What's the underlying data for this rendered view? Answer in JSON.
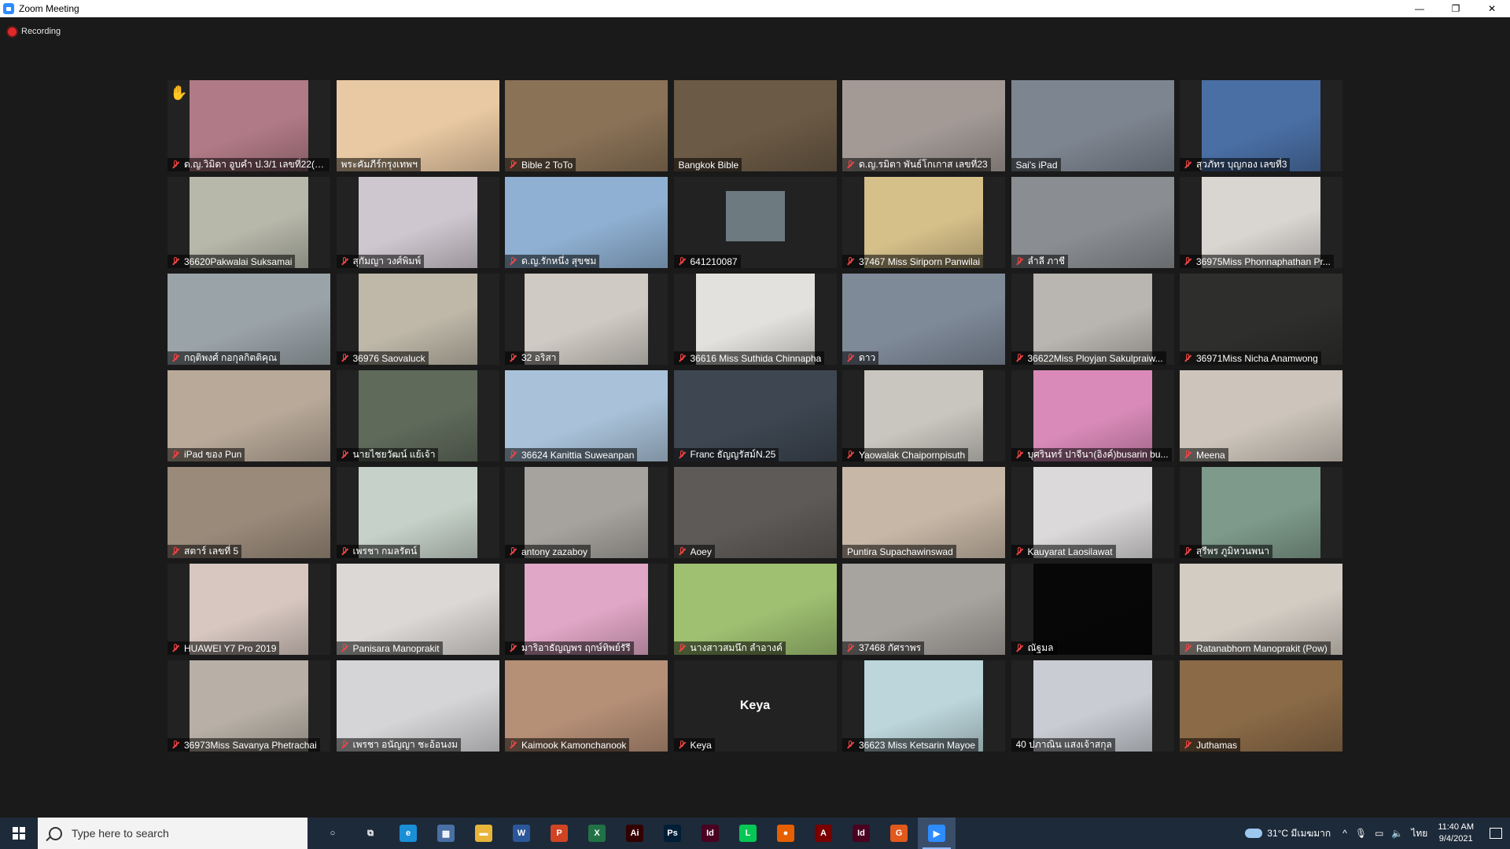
{
  "window": {
    "title": "Zoom Meeting",
    "minimize": "—",
    "restore": "❐",
    "close": "✕"
  },
  "recording": {
    "label": "Recording"
  },
  "participants": [
    {
      "name": "ด.ญ.วิมิดา อูบคำ ป.3/1 เลขที่22(N...",
      "muted": true,
      "video": "#b07a86",
      "style": "narrow2",
      "hand": true
    },
    {
      "name": "พระคัมภีร์กรุงเทพฯ",
      "muted": false,
      "video": "#e9c9a3",
      "style": "full"
    },
    {
      "name": "Bible 2 ToTo",
      "muted": true,
      "video": "#8a7257",
      "style": "full"
    },
    {
      "name": "Bangkok Bible",
      "muted": false,
      "video": "#6b5a45",
      "style": "full",
      "active": true
    },
    {
      "name": "ด.ญ.รมิตา พันธ์โกเกาส เลขที่23",
      "muted": true,
      "video": "#a39a96",
      "style": "full"
    },
    {
      "name": "Sai's iPad",
      "muted": false,
      "video": "#7d8590",
      "style": "full"
    },
    {
      "name": "สุวภัทร บุญกอง เลขที่3",
      "muted": true,
      "video": "#4a6fa5",
      "style": "narrow2"
    },
    {
      "name": "36620Pakwalai Suksamai",
      "muted": true,
      "video": "#b7b8aa",
      "style": "narrow2"
    },
    {
      "name": "สุกัมญา วงศ์พิมพ์",
      "muted": true,
      "video": "#cfc7cf",
      "style": "narrow2"
    },
    {
      "name": "ด.ญ.รักหนึ่ง สุขชม",
      "muted": true,
      "video": "#8fb0d2",
      "style": "full"
    },
    {
      "name": "641210087",
      "muted": true,
      "video": "#6d7a7f",
      "style": "tiny"
    },
    {
      "name": "37467 Miss Siriporn Panwilai",
      "muted": true,
      "video": "#d6c08a",
      "style": "narrow2"
    },
    {
      "name": "ลำลี ภาชี",
      "muted": true,
      "video": "#8a8e92",
      "style": "full"
    },
    {
      "name": "36975Miss Phonnaphathan Pr...",
      "muted": true,
      "video": "#d9d6d2",
      "style": "narrow2"
    },
    {
      "name": "กฤติพงศ์ กอกุลกิตติคุณ",
      "muted": true,
      "video": "#9aa3a8",
      "style": "full"
    },
    {
      "name": "36976 Saovaluck",
      "muted": true,
      "video": "#bfb8a9",
      "style": "narrow2"
    },
    {
      "name": "32 อริสา",
      "muted": true,
      "video": "#cfcac3",
      "style": "narrow"
    },
    {
      "name": "36616 Miss Suthida Chinnapha",
      "muted": true,
      "video": "#e3e1dd",
      "style": "narrow2"
    },
    {
      "name": "ดาว",
      "muted": true,
      "video": "#7f8a99",
      "style": "full"
    },
    {
      "name": "36622Miss Ployjan Sakulpraiw...",
      "muted": true,
      "video": "#b9b5b0",
      "style": "narrow2"
    },
    {
      "name": "36971Miss Nicha Anamwong",
      "muted": true,
      "video": "#2e2f2c",
      "style": "full"
    },
    {
      "name": "iPad ของ Pun",
      "muted": true,
      "video": "#b8a999",
      "style": "full"
    },
    {
      "name": "นายไชยวัฒน์ แย้เจ้า",
      "muted": true,
      "video": "#5f6a5b",
      "style": "narrow2"
    },
    {
      "name": "36624 Kanittia Suweanpan",
      "muted": true,
      "video": "#a9c2d9",
      "style": "full"
    },
    {
      "name": "Franc ธัญญรัสม์N.25",
      "muted": true,
      "video": "#3d4651",
      "style": "full"
    },
    {
      "name": "Yaowalak Chaipornpisuth",
      "muted": true,
      "video": "#c9c6bf",
      "style": "narrow2"
    },
    {
      "name": "บุศรินทร์ ปาจีนา(อิงค์)busarin bu...",
      "muted": true,
      "video": "#d98ab8",
      "style": "narrow2"
    },
    {
      "name": "Meena",
      "muted": true,
      "video": "#cdc5bb",
      "style": "full"
    },
    {
      "name": "สตาร์ เลขที่ 5",
      "muted": true,
      "video": "#9a8a7a",
      "style": "full"
    },
    {
      "name": "เพรชา กมลรัตน์",
      "muted": true,
      "video": "#c6d2c9",
      "style": "narrow2"
    },
    {
      "name": "antony zazaboy",
      "muted": true,
      "video": "#a6a39e",
      "style": "narrow"
    },
    {
      "name": "Aoey",
      "muted": true,
      "video": "#5e5a57",
      "style": "full"
    },
    {
      "name": "Puntira Supachawinswad",
      "muted": false,
      "video": "#c7b7a6",
      "style": "full"
    },
    {
      "name": "Kauyarat Laosilawat",
      "muted": true,
      "video": "#dbd9da",
      "style": "narrow2"
    },
    {
      "name": "สุรีพร ภูมิหวนพนา",
      "muted": true,
      "video": "#7d9a8a",
      "style": "narrow2"
    },
    {
      "name": "HUAWEI Y7 Pro 2019",
      "muted": true,
      "video": "#d7c7c0",
      "style": "narrow2"
    },
    {
      "name": "Panisara Manoprakit",
      "muted": true,
      "video": "#dcd8d5",
      "style": "full"
    },
    {
      "name": "มาริอาธัญญพร ฤกษ์ทิพย์รัรี",
      "muted": true,
      "video": "#e1a7c6",
      "style": "narrow"
    },
    {
      "name": "นางสาวสมนึก ลำอางค์",
      "muted": true,
      "video": "#9fc071",
      "style": "full"
    },
    {
      "name": "37468 กัศราพร",
      "muted": true,
      "video": "#a7a39f",
      "style": "full"
    },
    {
      "name": "ณัฐมล",
      "muted": true,
      "video": "#070707",
      "style": "narrow2"
    },
    {
      "name": "Ratanabhorn Manoprakit (Pow)",
      "muted": true,
      "video": "#d3ccc3",
      "style": "full"
    },
    {
      "name": "36973Miss Savanya Phetrachai",
      "muted": true,
      "video": "#b8b0a6",
      "style": "narrow2"
    },
    {
      "name": "เพรชา อนัญญา ชะอ้อนงม",
      "muted": true,
      "video": "#d5d5d8",
      "style": "full"
    },
    {
      "name": "Kaimook Kamonchanook",
      "muted": true,
      "video": "#b58f76",
      "style": "full"
    },
    {
      "name": "Keya",
      "muted": true,
      "video": "none",
      "style": "none",
      "center": "Keya"
    },
    {
      "name": "36623 Miss Ketsarin Mayoe",
      "muted": true,
      "video": "#bcd6db",
      "style": "narrow2"
    },
    {
      "name": "40 ปภาณิน แสงเจ้าสกุล",
      "muted": false,
      "video": "#c9cdd3",
      "style": "narrow2"
    },
    {
      "name": "Juthamas",
      "muted": true,
      "video": "#8a6a47",
      "style": "full"
    }
  ],
  "taskbar": {
    "search_placeholder": "Type here to search",
    "apps": [
      {
        "icon": "cortana-icon",
        "glyph": "○",
        "bg": "transparent"
      },
      {
        "icon": "task-view-icon",
        "glyph": "⧉",
        "bg": "transparent"
      },
      {
        "icon": "edge-icon",
        "glyph": "e",
        "bg": "#1b8fd6"
      },
      {
        "icon": "calculator-icon",
        "glyph": "▦",
        "bg": "#4a6fa5"
      },
      {
        "icon": "file-explorer-icon",
        "glyph": "▬",
        "bg": "#e8b43a"
      },
      {
        "icon": "word-icon",
        "glyph": "W",
        "bg": "#2b579a"
      },
      {
        "icon": "powerpoint-icon",
        "glyph": "P",
        "bg": "#d04423"
      },
      {
        "icon": "excel-icon",
        "glyph": "X",
        "bg": "#217346"
      },
      {
        "icon": "illustrator-icon",
        "glyph": "Ai",
        "bg": "#330000"
      },
      {
        "icon": "photoshop-icon",
        "glyph": "Ps",
        "bg": "#001e36"
      },
      {
        "icon": "indesign-icon",
        "glyph": "Id",
        "bg": "#49021f"
      },
      {
        "icon": "line-icon",
        "glyph": "L",
        "bg": "#06c755"
      },
      {
        "icon": "firefox-icon",
        "glyph": "●",
        "bg": "#e66000"
      },
      {
        "icon": "acrobat-icon",
        "glyph": "A",
        "bg": "#7a0000"
      },
      {
        "icon": "indesign-icon-2",
        "glyph": "Id",
        "bg": "#49021f"
      },
      {
        "icon": "grammarly-icon",
        "glyph": "G",
        "bg": "#e2591c"
      },
      {
        "icon": "zoom-icon",
        "glyph": "▶",
        "bg": "#2d8cff",
        "active": true
      }
    ],
    "weather": "31°C มีเมฆมาก",
    "chevron": "^",
    "mic": "🎙",
    "network": "▭",
    "volume": "🔈",
    "language": "ไทย",
    "time": "11:40 AM",
    "date": "9/4/2021"
  }
}
